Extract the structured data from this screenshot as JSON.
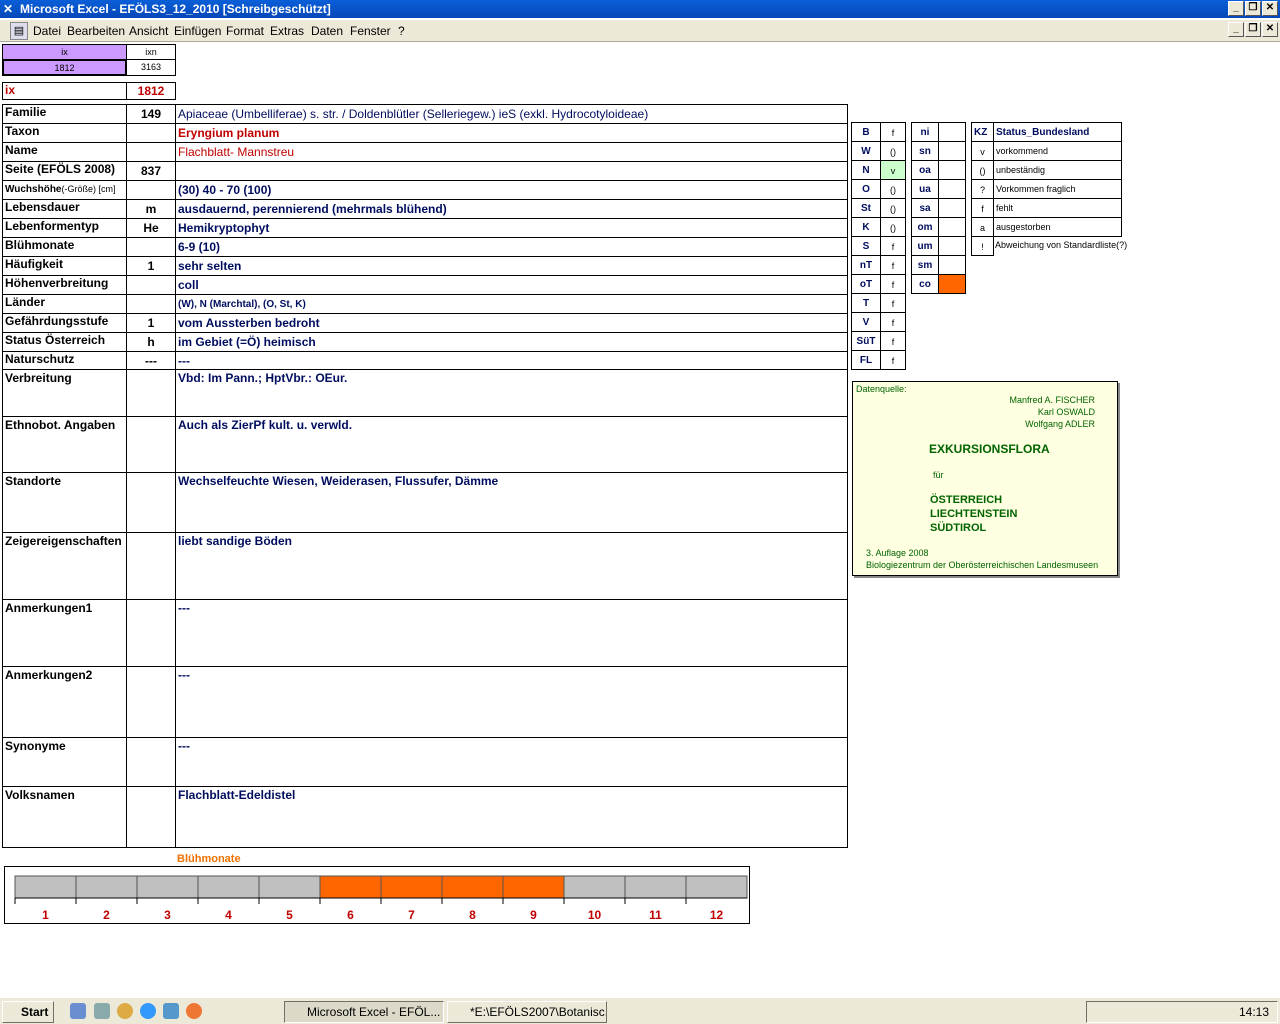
{
  "window": {
    "title": "Microsoft Excel - EFÖLS3_12_2010  [Schreibgeschützt]"
  },
  "menu": [
    "Datei",
    "Bearbeiten",
    "Ansicht",
    "Einfügen",
    "Format",
    "Extras",
    "Daten",
    "Fenster",
    "?"
  ],
  "index": {
    "ix_hdr": "ix",
    "ixn_hdr": "ixn",
    "ix_val": "1812",
    "ixn_val": "3163",
    "ix_label": "ix",
    "ix_big": "1812"
  },
  "rows": [
    {
      "label": "Familie",
      "code": "149",
      "value": "Apiaceae (Umbelliferae) s. str.  /  Doldenblütler (Selleriegew.) ieS (exkl. Hydrocotyloideae)"
    },
    {
      "label": "Taxon",
      "code": "",
      "value": "Eryngium planum"
    },
    {
      "label": "Name",
      "code": "",
      "value": "Flachblatt- Mannstreu"
    },
    {
      "label": "Seite (EFÖLS 2008)",
      "code": "837",
      "value": ""
    },
    {
      "label": "Wuchshöhe",
      "label_sub": "(-Größe) [cm]",
      "code": "",
      "value": " (30) 40 - 70 (100)"
    },
    {
      "label": "Lebensdauer",
      "code": "m",
      "value": "ausdauernd, perennierend (mehrmals blühend)"
    },
    {
      "label": "Lebenformentyp",
      "code": "He",
      "value": "Hemikryptophyt"
    },
    {
      "label": "Blühmonate",
      "code": "",
      "value": " 6-9 (10)"
    },
    {
      "label": "Häufigkeit",
      "code": "1",
      "value": "sehr selten"
    },
    {
      "label": "Höhenverbreitung",
      "code": "",
      "value": "coll"
    },
    {
      "label": "Länder",
      "code": "",
      "value": "(W), N (Marchtal), (O, St, K)"
    },
    {
      "label": "Gefährdungsstufe",
      "code": "1",
      "value": "vom Aussterben bedroht"
    },
    {
      "label": "Status Österreich",
      "code": "h",
      "value": "im Gebiet (=Ö) heimisch"
    },
    {
      "label": "Naturschutz",
      "code": "---",
      "value": " ---"
    }
  ],
  "tall_rows": [
    {
      "label": "Verbreitung",
      "value": "Vbd:  Im Pann.;  HptVbr.: OEur."
    },
    {
      "label": "Ethnobot. Angaben",
      "value": "Auch als ZierPf kult. u. verwld."
    },
    {
      "label": "Standorte",
      "value": "Wechselfeuchte Wiesen, Weiderasen, Flussufer, Dämme"
    },
    {
      "label": "Zeigereigenschaften",
      "value": "liebt sandige Böden"
    },
    {
      "label": "Anmerkungen1",
      "value": "---"
    },
    {
      "label": "Anmerkungen2",
      "value": "---"
    },
    {
      "label": "Synonyme",
      "value": "---"
    },
    {
      "label": "Volksnamen",
      "value": "Flachblatt-Edeldistel"
    }
  ],
  "states": [
    {
      "k": "B",
      "v": "f"
    },
    {
      "k": "W",
      "v": "()"
    },
    {
      "k": "N",
      "v": "v"
    },
    {
      "k": "O",
      "v": "()"
    },
    {
      "k": "St",
      "v": "()"
    },
    {
      "k": "K",
      "v": "()"
    },
    {
      "k": "S",
      "v": "f"
    },
    {
      "k": "nT",
      "v": "f"
    },
    {
      "k": "oT",
      "v": "f"
    },
    {
      "k": "T",
      "v": "f"
    },
    {
      "k": "V",
      "v": "f"
    },
    {
      "k": "SüT",
      "v": "f"
    },
    {
      "k": "FL",
      "v": "f"
    }
  ],
  "altitude": [
    {
      "k": "ni",
      "v": ""
    },
    {
      "k": "sn",
      "v": ""
    },
    {
      "k": "oa",
      "v": ""
    },
    {
      "k": "ua",
      "v": ""
    },
    {
      "k": "sa",
      "v": ""
    },
    {
      "k": "om",
      "v": ""
    },
    {
      "k": "um",
      "v": ""
    },
    {
      "k": "sm",
      "v": ""
    },
    {
      "k": "co",
      "v": ""
    }
  ],
  "legend": {
    "hdr_k": "KZ",
    "hdr_v": "Status_Bundesland",
    "items": [
      {
        "k": "v",
        "v": "vorkommend"
      },
      {
        "k": "()",
        "v": "unbeständig"
      },
      {
        "k": "?",
        "v": "Vorkommen fraglich"
      },
      {
        "k": "f",
        "v": "fehlt"
      },
      {
        "k": "a",
        "v": "ausgestorben"
      },
      {
        "k": "!",
        "v": "Abweichung von Standardliste(?)"
      }
    ]
  },
  "datasource": {
    "hdr": "Datenquelle:",
    "authors": [
      "Manfred A. FISCHER",
      "Karl OSWALD",
      "Wolfgang ADLER"
    ],
    "title": "EXKURSIONSFLORA",
    "fuer": "für",
    "countries": [
      "ÖSTERREICH",
      "LIECHTENSTEIN",
      "SÜDTIROL"
    ],
    "edition": "3. Auflage 2008",
    "publisher": "Biologiezentrum der Oberösterreichischen Landesmuseen"
  },
  "chart_data": {
    "type": "bar",
    "title": "Blühmonate",
    "categories": [
      "1",
      "2",
      "3",
      "4",
      "5",
      "6",
      "7",
      "8",
      "9",
      "10",
      "11",
      "12"
    ],
    "values": [
      0,
      0,
      0,
      0,
      0,
      1,
      1,
      1,
      1,
      0,
      0,
      0
    ],
    "colors": {
      "on": "#ff6600",
      "off": "#c0c0c0"
    }
  },
  "taskbar": {
    "start": "Start",
    "tasks": [
      "Microsoft Excel - EFÖL...",
      "*E:\\EFÖLS2007\\Botanisc..."
    ],
    "clock": "14:13"
  }
}
